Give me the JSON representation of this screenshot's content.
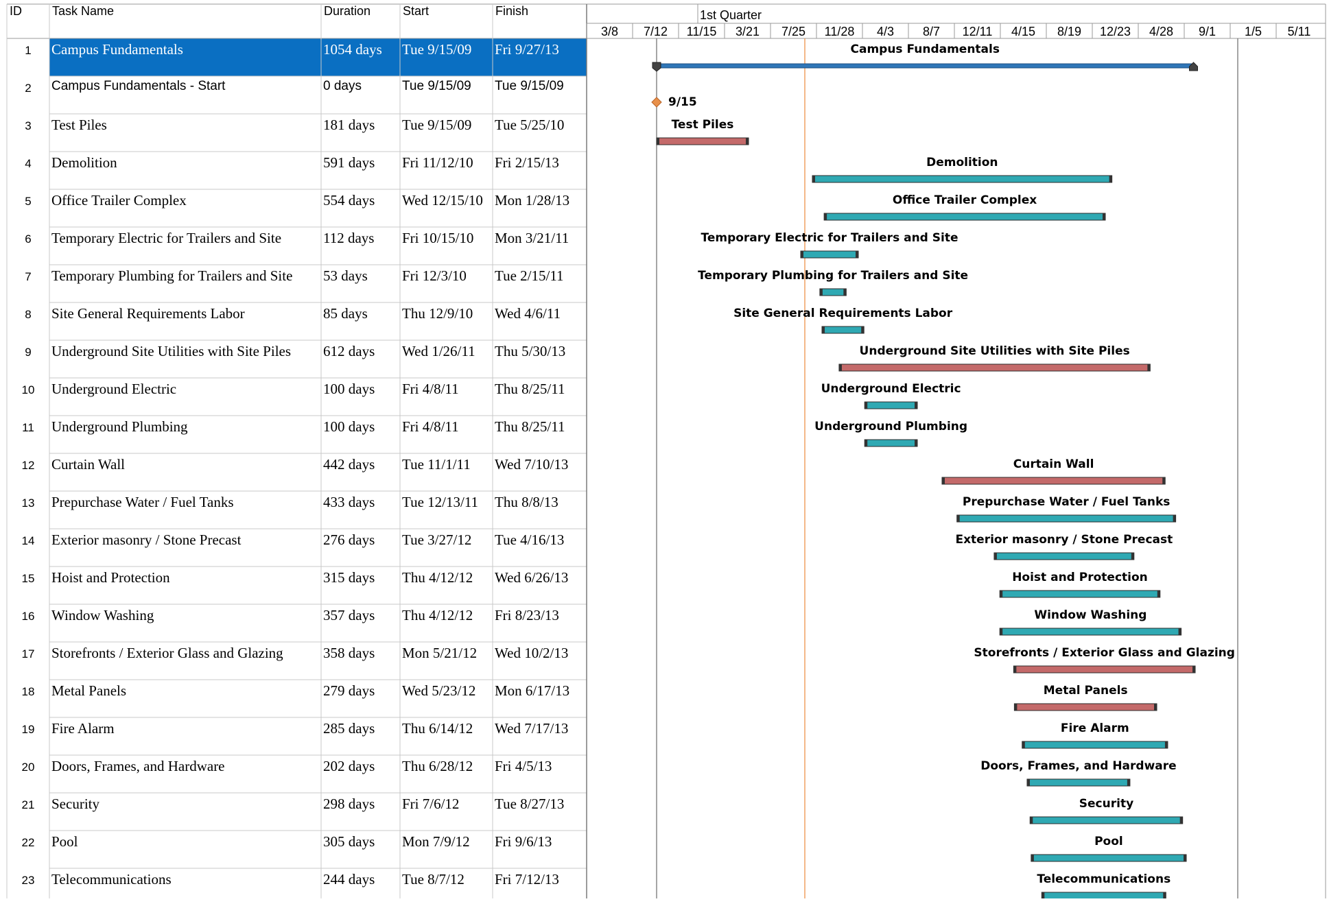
{
  "columns": {
    "id": "ID",
    "name": "Task Name",
    "duration": "Duration",
    "start": "Start",
    "finish": "Finish"
  },
  "timescale": {
    "top_label": "1st Quarter",
    "ticks": [
      "3/8",
      "7/12",
      "11/15",
      "3/21",
      "7/25",
      "11/28",
      "4/3",
      "8/7",
      "12/11",
      "4/15",
      "8/19",
      "12/23",
      "4/28",
      "9/1",
      "1/5",
      "5/11"
    ]
  },
  "colors": {
    "selected_row": "#0a6fc2",
    "summary_bar": "#2f76b8",
    "critical_bar": "#c46a6a",
    "normal_bar": "#2fa9b3",
    "milestone": "#e8904a",
    "status_line": "#f0a060",
    "grid_line": "#c8c8c8"
  },
  "tasks": [
    {
      "id": "1",
      "name": "Campus Fundamentals",
      "duration": "1054 days",
      "start": "Tue 9/15/09",
      "finish": "Fri 9/27/13",
      "type": "summary",
      "start_date": "2009-09-15",
      "finish_date": "2013-09-27",
      "label": "Campus Fundamentals"
    },
    {
      "id": "2",
      "name": "Campus Fundamentals - Start",
      "duration": "0 days",
      "start": "Tue 9/15/09",
      "finish": "Tue 9/15/09",
      "type": "milestone",
      "start_date": "2009-09-15",
      "finish_date": "2009-09-15",
      "label": "9/15"
    },
    {
      "id": "3",
      "name": "Test Piles",
      "duration": "181 days",
      "start": "Tue 9/15/09",
      "finish": "Tue 5/25/10",
      "type": "critical",
      "start_date": "2009-09-15",
      "finish_date": "2010-05-25",
      "label": "Test Piles"
    },
    {
      "id": "4",
      "name": "Demolition",
      "duration": "591 days",
      "start": "Fri 11/12/10",
      "finish": "Fri 2/15/13",
      "type": "normal",
      "start_date": "2010-11-12",
      "finish_date": "2013-02-15",
      "label": "Demolition"
    },
    {
      "id": "5",
      "name": "Office Trailer Complex",
      "duration": "554 days",
      "start": "Wed 12/15/10",
      "finish": "Mon 1/28/13",
      "type": "normal",
      "start_date": "2010-12-15",
      "finish_date": "2013-01-28",
      "label": "Office Trailer Complex"
    },
    {
      "id": "6",
      "name": "Temporary Electric for Trailers and Site",
      "duration": "112 days",
      "start": "Fri 10/15/10",
      "finish": "Mon 3/21/11",
      "type": "normal",
      "start_date": "2010-10-15",
      "finish_date": "2011-03-21",
      "label": "Temporary Electric for Trailers and Site"
    },
    {
      "id": "7",
      "name": "Temporary Plumbing for Trailers and Site",
      "duration": "53 days",
      "start": "Fri 12/3/10",
      "finish": "Tue 2/15/11",
      "type": "normal",
      "start_date": "2010-12-03",
      "finish_date": "2011-02-15",
      "label": "Temporary Plumbing for Trailers and Site"
    },
    {
      "id": "8",
      "name": "Site General Requirements Labor",
      "duration": "85 days",
      "start": "Thu 12/9/10",
      "finish": "Wed 4/6/11",
      "type": "normal",
      "start_date": "2010-12-09",
      "finish_date": "2011-04-06",
      "label": "Site General Requirements Labor"
    },
    {
      "id": "9",
      "name": "Underground Site Utilities with Site Piles",
      "duration": "612 days",
      "start": "Wed 1/26/11",
      "finish": "Thu 5/30/13",
      "type": "critical",
      "start_date": "2011-01-26",
      "finish_date": "2013-05-30",
      "label": "Underground Site Utilities with Site Piles"
    },
    {
      "id": "10",
      "name": "Underground Electric",
      "duration": "100 days",
      "start": "Fri 4/8/11",
      "finish": "Thu 8/25/11",
      "type": "normal",
      "start_date": "2011-04-08",
      "finish_date": "2011-08-25",
      "label": "Underground Electric"
    },
    {
      "id": "11",
      "name": "Underground Plumbing",
      "duration": "100 days",
      "start": "Fri 4/8/11",
      "finish": "Thu 8/25/11",
      "type": "normal",
      "start_date": "2011-04-08",
      "finish_date": "2011-08-25",
      "label": "Underground Plumbing"
    },
    {
      "id": "12",
      "name": "Curtain Wall",
      "duration": "442 days",
      "start": "Tue 11/1/11",
      "finish": "Wed 7/10/13",
      "type": "critical",
      "start_date": "2011-11-01",
      "finish_date": "2013-07-10",
      "label": "Curtain Wall"
    },
    {
      "id": "13",
      "name": "Prepurchase Water / Fuel Tanks",
      "duration": "433 days",
      "start": "Tue 12/13/11",
      "finish": "Thu 8/8/13",
      "type": "normal",
      "start_date": "2011-12-13",
      "finish_date": "2013-08-08",
      "label": "Prepurchase Water / Fuel Tanks"
    },
    {
      "id": "14",
      "name": "Exterior masonry / Stone Precast",
      "duration": "276 days",
      "start": "Tue 3/27/12",
      "finish": "Tue 4/16/13",
      "type": "normal",
      "start_date": "2012-03-27",
      "finish_date": "2013-04-16",
      "label": "Exterior masonry / Stone Precast"
    },
    {
      "id": "15",
      "name": "Hoist and Protection",
      "duration": "315 days",
      "start": "Thu 4/12/12",
      "finish": "Wed 6/26/13",
      "type": "normal",
      "start_date": "2012-04-12",
      "finish_date": "2013-06-26",
      "label": "Hoist and Protection"
    },
    {
      "id": "16",
      "name": "Window Washing",
      "duration": "357 days",
      "start": "Thu 4/12/12",
      "finish": "Fri 8/23/13",
      "type": "normal",
      "start_date": "2012-04-12",
      "finish_date": "2013-08-23",
      "label": "Window Washing"
    },
    {
      "id": "17",
      "name": "Storefronts / Exterior Glass and Glazing",
      "duration": "358 days",
      "start": "Mon 5/21/12",
      "finish": "Wed 10/2/13",
      "type": "critical",
      "start_date": "2012-05-21",
      "finish_date": "2013-10-02",
      "label": "Storefronts / Exterior Glass and Glazing"
    },
    {
      "id": "18",
      "name": "Metal Panels",
      "duration": "279 days",
      "start": "Wed 5/23/12",
      "finish": "Mon 6/17/13",
      "type": "critical",
      "start_date": "2012-05-23",
      "finish_date": "2013-06-17",
      "label": "Metal Panels"
    },
    {
      "id": "19",
      "name": "Fire Alarm",
      "duration": "285 days",
      "start": "Thu 6/14/12",
      "finish": "Wed 7/17/13",
      "type": "normal",
      "start_date": "2012-06-14",
      "finish_date": "2013-07-17",
      "label": "Fire Alarm"
    },
    {
      "id": "20",
      "name": "Doors, Frames, and Hardware",
      "duration": "202 days",
      "start": "Thu 6/28/12",
      "finish": "Fri 4/5/13",
      "type": "normal",
      "start_date": "2012-06-28",
      "finish_date": "2013-04-05",
      "label": "Doors, Frames, and Hardware"
    },
    {
      "id": "21",
      "name": "Security",
      "duration": "298 days",
      "start": "Fri 7/6/12",
      "finish": "Tue 8/27/13",
      "type": "normal",
      "start_date": "2012-07-06",
      "finish_date": "2013-08-27",
      "label": "Security"
    },
    {
      "id": "22",
      "name": "Pool",
      "duration": "305 days",
      "start": "Mon 7/9/12",
      "finish": "Fri 9/6/13",
      "type": "normal",
      "start_date": "2012-07-09",
      "finish_date": "2013-09-06",
      "label": "Pool"
    },
    {
      "id": "23",
      "name": "Telecommunications",
      "duration": "244 days",
      "start": "Tue 8/7/12",
      "finish": "Fri 7/12/13",
      "type": "normal",
      "start_date": "2012-08-07",
      "finish_date": "2013-07-12",
      "label": "Telecommunications"
    }
  ]
}
